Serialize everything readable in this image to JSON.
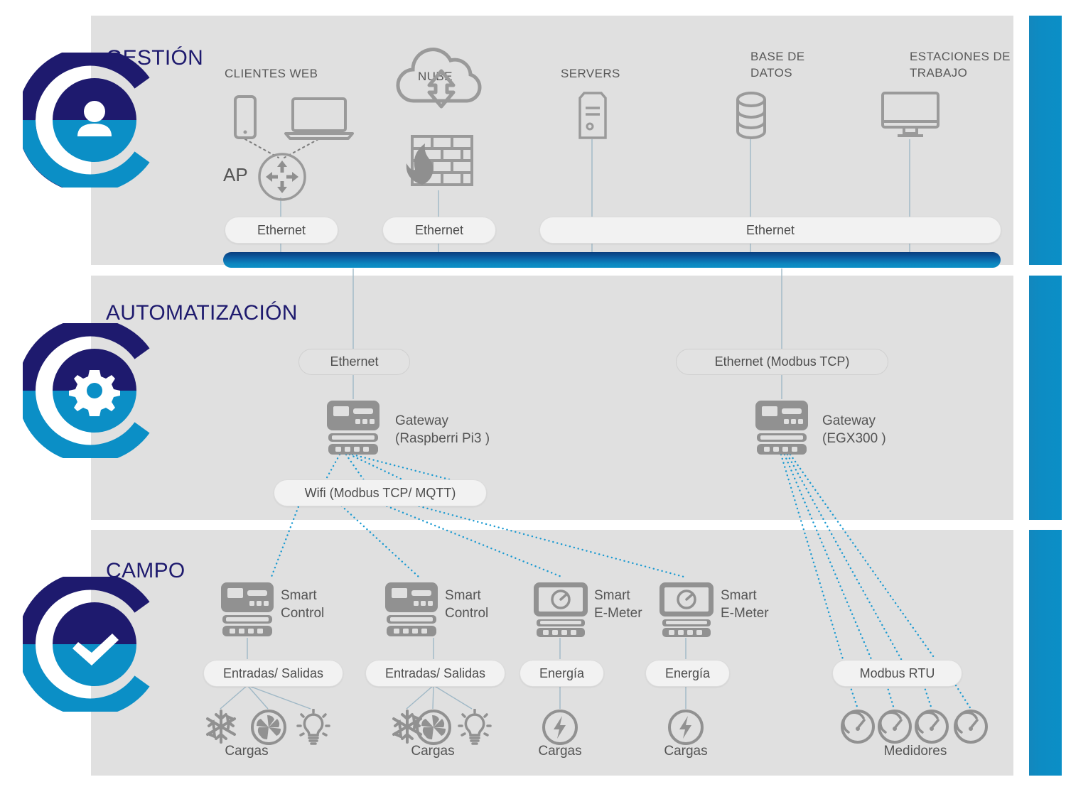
{
  "colors": {
    "panel_bg": "#e0e0e0",
    "accent_cyan": "#0b8fc6",
    "navy": "#1e1a6e",
    "icon_gray": "#999999",
    "text_gray": "#595959",
    "dotted_blue": "#1b9ad1",
    "bus_dark": "#0a3d7d"
  },
  "layers": [
    {
      "id": "gestion",
      "title": "GESTIÓN",
      "badge_icon": "user-icon"
    },
    {
      "id": "automatizacion",
      "title": "AUTOMATIZACIÓN",
      "badge_icon": "gear-icon"
    },
    {
      "id": "campo",
      "title": "CAMPO",
      "badge_icon": "check-icon"
    }
  ],
  "management": {
    "nodes": [
      {
        "name": "clientes-web",
        "label": "CLIENTES WEB",
        "icons": [
          "smartphone-icon",
          "laptop-icon"
        ]
      },
      {
        "name": "nube",
        "label": "NUBE",
        "icons": [
          "cloud-icon",
          "firewall-icon"
        ]
      },
      {
        "name": "servers",
        "label": "SERVERS",
        "icons": [
          "server-icon"
        ]
      },
      {
        "name": "base-de-datos",
        "label": "BASE DE\nDATOS",
        "icons": [
          "database-icon"
        ]
      },
      {
        "name": "estaciones",
        "label": "ESTACIONES DE\nTRABAJO",
        "icons": [
          "desktop-monitor-icon"
        ]
      }
    ],
    "ap_label": "AP",
    "ap_icon": "access-point-icon",
    "buses": [
      {
        "name": "ethernet-pill-clients",
        "label": "Ethernet"
      },
      {
        "name": "ethernet-pill-cloud",
        "label": "Ethernet"
      },
      {
        "name": "ethernet-pill-wide",
        "label": "Ethernet"
      }
    ]
  },
  "automation": {
    "links": [
      {
        "name": "ethernet-pill-automation",
        "label": "Ethernet"
      },
      {
        "name": "ethernet-modbus-tcp-pill",
        "label": "Ethernet (Modbus TCP)"
      }
    ],
    "gateways": [
      {
        "name": "gateway-raspberry-pi",
        "label": "Gateway\n(Raspberri Pi3 )",
        "icon": "gateway-icon"
      },
      {
        "name": "gateway-egx300",
        "label": "Gateway\n(EGX300 )",
        "icon": "gateway-icon"
      }
    ],
    "wifi_pill": {
      "name": "wifi-modbus-mqtt-pill",
      "label": "Wifi (Modbus TCP/ MQTT)"
    }
  },
  "field": {
    "devices": [
      {
        "name": "smart-control-1",
        "label": "Smart\nControl",
        "icon": "controller-icon",
        "bus": "Entradas/ Salidas",
        "bus_name": "entradas-salidas-pill-1",
        "loads": [
          "snowflake-icon",
          "fan-icon",
          "lightbulb-icon"
        ],
        "loads_label": "Cargas"
      },
      {
        "name": "smart-control-2",
        "label": "Smart\nControl",
        "icon": "controller-icon",
        "bus": "Entradas/ Salidas",
        "bus_name": "entradas-salidas-pill-2",
        "loads": [
          "snowflake-icon",
          "fan-icon",
          "lightbulb-icon"
        ],
        "loads_label": "Cargas"
      },
      {
        "name": "smart-emeter-1",
        "label": "Smart\nE-Meter",
        "icon": "emeter-icon",
        "bus": "Energía",
        "bus_name": "energia-pill-1",
        "loads": [
          "energy-bolt-icon"
        ],
        "loads_label": "Cargas"
      },
      {
        "name": "smart-emeter-2",
        "label": "Smart\nE-Meter",
        "icon": "emeter-icon",
        "bus": "Energía",
        "bus_name": "energia-pill-2",
        "loads": [
          "energy-bolt-icon"
        ],
        "loads_label": "Cargas"
      }
    ],
    "modbus_rtu": {
      "name": "modbus-rtu-pill",
      "label": "Modbus RTU",
      "meters_label": "Medidores",
      "meters": [
        "gauge-meter-icon",
        "gauge-meter-icon",
        "gauge-meter-icon",
        "gauge-meter-icon"
      ]
    }
  }
}
